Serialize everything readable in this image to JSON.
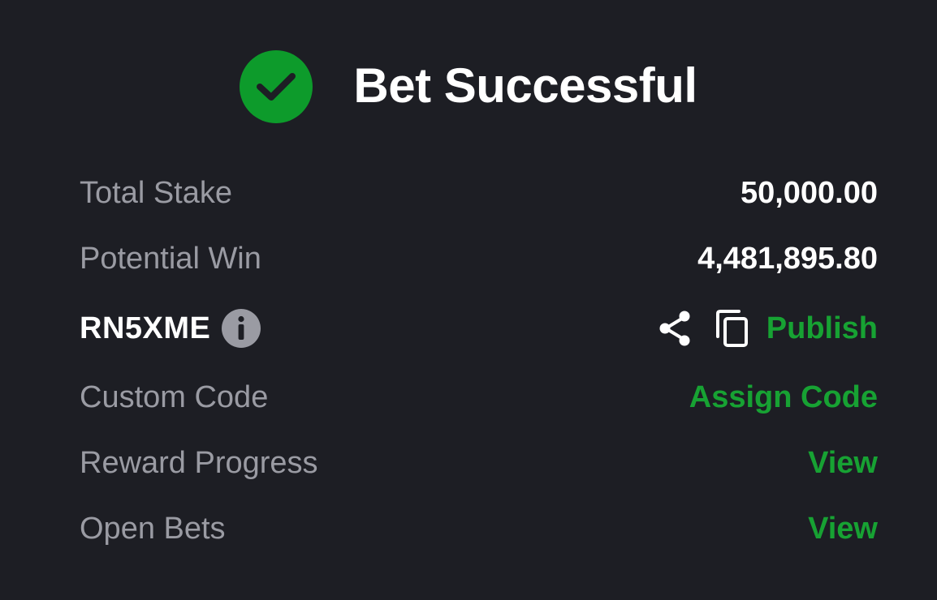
{
  "header": {
    "title": "Bet Successful",
    "icon": "check-circle-icon",
    "accent_color": "#0d9b2b"
  },
  "summary": {
    "total_stake_label": "Total Stake",
    "total_stake_value": "50,000.00",
    "potential_win_label": "Potential Win",
    "potential_win_value": "4,481,895.80"
  },
  "booking": {
    "code": "RN5XME",
    "info_icon": "info-icon",
    "share_icon": "share-icon",
    "copy_icon": "copy-icon",
    "publish_label": "Publish"
  },
  "custom_code": {
    "label": "Custom Code",
    "action_label": "Assign Code"
  },
  "reward_progress": {
    "label": "Reward Progress",
    "action_label": "View"
  },
  "open_bets": {
    "label": "Open Bets",
    "action_label": "View"
  },
  "colors": {
    "background": "#1d1e24",
    "label_text": "#9a9ba3",
    "value_text": "#ffffff",
    "link_green": "#17a233"
  }
}
